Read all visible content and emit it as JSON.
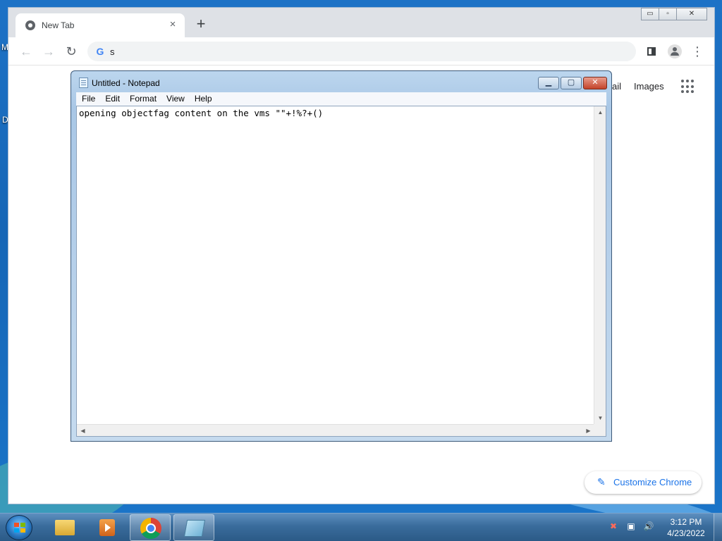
{
  "desktop": {
    "edge_letters": [
      "M",
      "D"
    ]
  },
  "browser": {
    "tab": {
      "title": "New Tab",
      "close_glyph": "×"
    },
    "new_tab_glyph": "+",
    "window_controls": {
      "minimize": "▭",
      "maximize": "▫",
      "close": "✕"
    },
    "nav": {
      "back": "←",
      "forward": "→",
      "reload": "↻"
    },
    "omnibox": {
      "value": "s",
      "search_icon": "G"
    },
    "links": {
      "gmail": "ail",
      "images": "Images"
    },
    "customize_label": "Customize Chrome",
    "customize_icon": "✎"
  },
  "notepad": {
    "title": "Untitled - Notepad",
    "menu": [
      "File",
      "Edit",
      "Format",
      "View",
      "Help"
    ],
    "content": "opening objectfag content on the vms \"\"+!%?+()",
    "controls": {
      "minimize": "▁",
      "maximize": "▢",
      "close": "✕"
    }
  },
  "taskbar": {
    "apps": [
      {
        "name": "Windows Explorer",
        "active": false
      },
      {
        "name": "Windows Media Player",
        "active": false
      },
      {
        "name": "Google Chrome",
        "active": true
      },
      {
        "name": "Notepad",
        "active": true
      }
    ],
    "tray_icons": [
      "✖",
      "▣",
      "🔊"
    ],
    "clock": {
      "time": "3:12 PM",
      "date": "4/23/2022"
    }
  }
}
